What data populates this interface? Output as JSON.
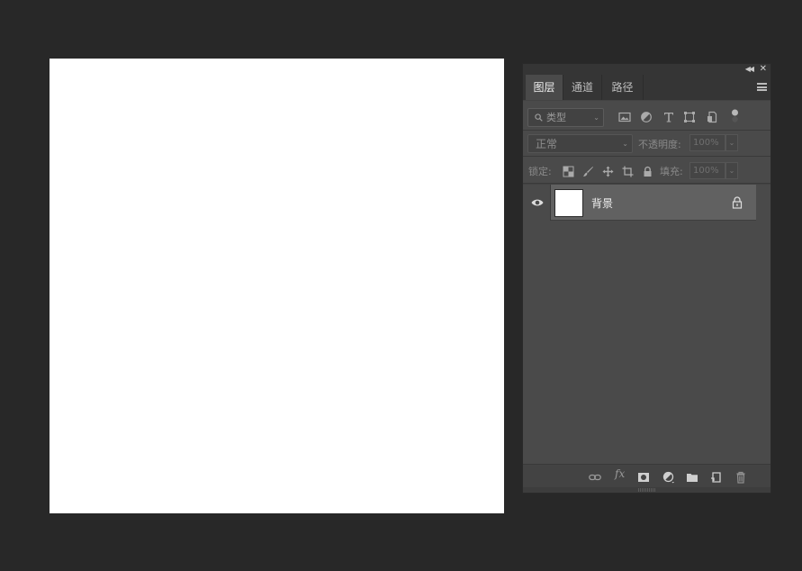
{
  "panel": {
    "tabs": [
      {
        "label": "图层",
        "active": true
      },
      {
        "label": "通道",
        "active": false
      },
      {
        "label": "路径",
        "active": false
      }
    ]
  },
  "filter": {
    "kind_label": "类型",
    "icons": [
      "image-filter-icon",
      "adjustment-filter-icon",
      "type-filter-icon",
      "shape-filter-icon",
      "smart-object-filter-icon"
    ]
  },
  "blend": {
    "mode": "正常",
    "opacity_label": "不透明度:",
    "opacity_value": "100%"
  },
  "lock": {
    "label": "锁定:",
    "fill_label": "填充:",
    "fill_value": "100%"
  },
  "layers": [
    {
      "name": "背景",
      "visible": true,
      "locked": true
    }
  ],
  "colors": {
    "workspace_bg": "#282828",
    "panel_bg": "#4a4a4a",
    "selected_layer_bg": "#616161",
    "canvas_bg": "#ffffff"
  }
}
